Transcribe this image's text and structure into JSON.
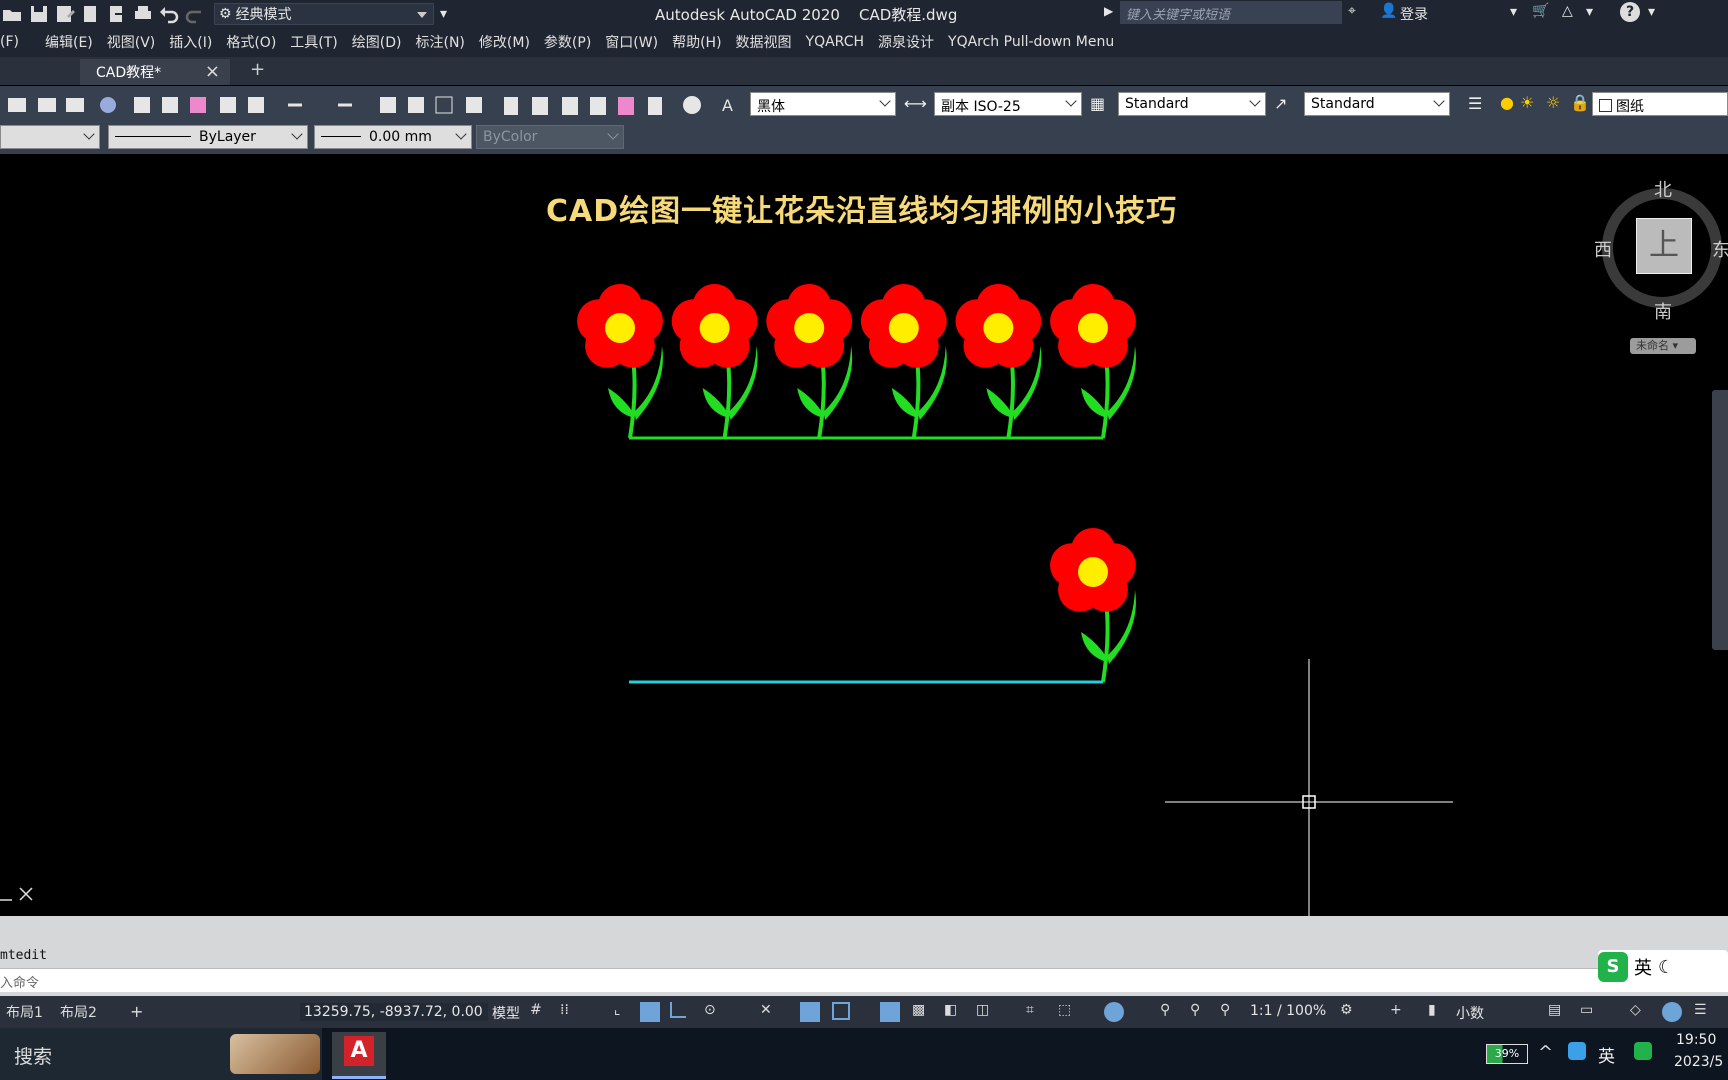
{
  "colors": {
    "flower_petal": "#ff0000",
    "flower_center": "#ffee00",
    "stem": "#22dd22",
    "line_top": "#22dd22",
    "line_bottom": "#22d0d8",
    "title_color": "#f6da7a"
  },
  "titlebar": {
    "workspace": "经典模式",
    "app_title": "Autodesk AutoCAD 2020    CAD教程.dwg",
    "search_placeholder": "键入关键字或短语",
    "login": "登录"
  },
  "menu": [
    "(F)",
    "编辑(E)",
    "视图(V)",
    "插入(I)",
    "格式(O)",
    "工具(T)",
    "绘图(D)",
    "标注(N)",
    "修改(M)",
    "参数(P)",
    "窗口(W)",
    "帮助(H)",
    "数据视图",
    "YQARCH",
    "源泉设计",
    "YQArch Pull-down Menu"
  ],
  "tabs": {
    "active": "CAD教程*",
    "close": "×",
    "new": "+"
  },
  "toolbar": {
    "text_style": "黑体",
    "dim_style": "副本 ISO-25",
    "table_style": "Standard",
    "mleader_style": "Standard",
    "paper_label": "图纸",
    "linetype": "ByLayer",
    "lineweight": "0.00 mm",
    "plotstyle": "ByColor"
  },
  "drawing": {
    "title": "CAD绘图一键让花朵沿直线均匀排例的小技巧",
    "top_row_flower_count": 6
  },
  "viewcube": {
    "north": "北",
    "south": "南",
    "west": "西",
    "east": "东",
    "face": "上",
    "ucs": "未命名"
  },
  "command": {
    "history": "mtedit",
    "prompt": "入命令"
  },
  "statusbar": {
    "layout1": "布局1",
    "layout2": "布局2",
    "add": "+",
    "coords": "13259.75, -8937.72, 0.00",
    "model": "模型",
    "scale": "1:1 / 100%",
    "units": "小数"
  },
  "taskbar": {
    "search": "搜索",
    "battery": "39%",
    "ime": "英",
    "ime_toolbar": "英",
    "time": "19:50",
    "date": "2023/5"
  }
}
